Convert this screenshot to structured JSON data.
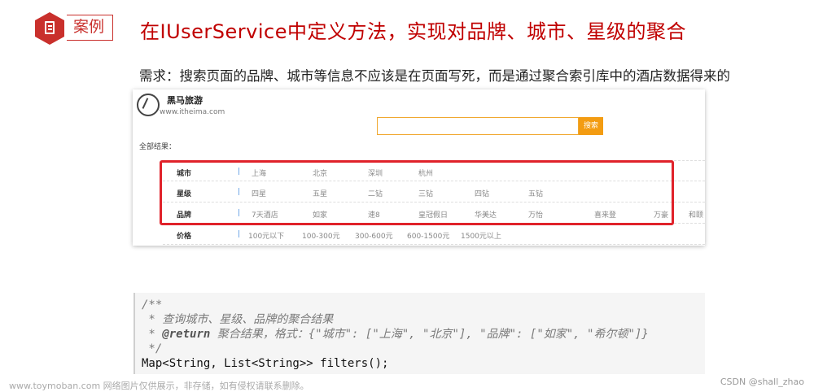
{
  "header": {
    "case_label": "案例",
    "title": "在IUserService中定义方法，实现对品牌、城市、星级的聚合",
    "requirement": "需求：搜索页面的品牌、城市等信息不应该是在页面写死，而是通过聚合索引库中的酒店数据得来的"
  },
  "screenshot": {
    "brand": "黑马旅游",
    "brand_url": "www.itheima.com",
    "search_placeholder": "",
    "search_button": "搜索",
    "all_results": "全部结果：",
    "rows": [
      {
        "key": "城市",
        "values": [
          "上海",
          "北京",
          "深圳",
          "杭州"
        ]
      },
      {
        "key": "星级",
        "values": [
          "四星",
          "五星",
          "二钻",
          "三钻",
          "四钻",
          "五钻"
        ]
      },
      {
        "key": "品牌",
        "values": [
          "7天酒店",
          "如家",
          "速8",
          "皇冠假日",
          "华美达",
          "万怡",
          "喜来登",
          "万豪",
          "和颐"
        ]
      },
      {
        "key": "价格",
        "values": [
          "100元以下",
          "100-300元",
          "300-600元",
          "600-1500元",
          "1500元以上"
        ]
      }
    ]
  },
  "code": {
    "line1": "/**",
    "line2": " * 查询城市、星级、品牌的聚合结果",
    "line3_tag": "@return",
    "line3_text": " 聚合结果，格式：{\"城市\": [\"上海\", \"北京\"], \"品牌\": [\"如家\", \"希尔顿\"]}",
    "line4": " */",
    "line5": "Map<String, List<String>> filters();"
  },
  "footer": {
    "watermark": "www.toymoban.com 网络图片仅供展示，非存储，如有侵权请联系删除。",
    "credit": "CSDN @shall_zhao"
  }
}
